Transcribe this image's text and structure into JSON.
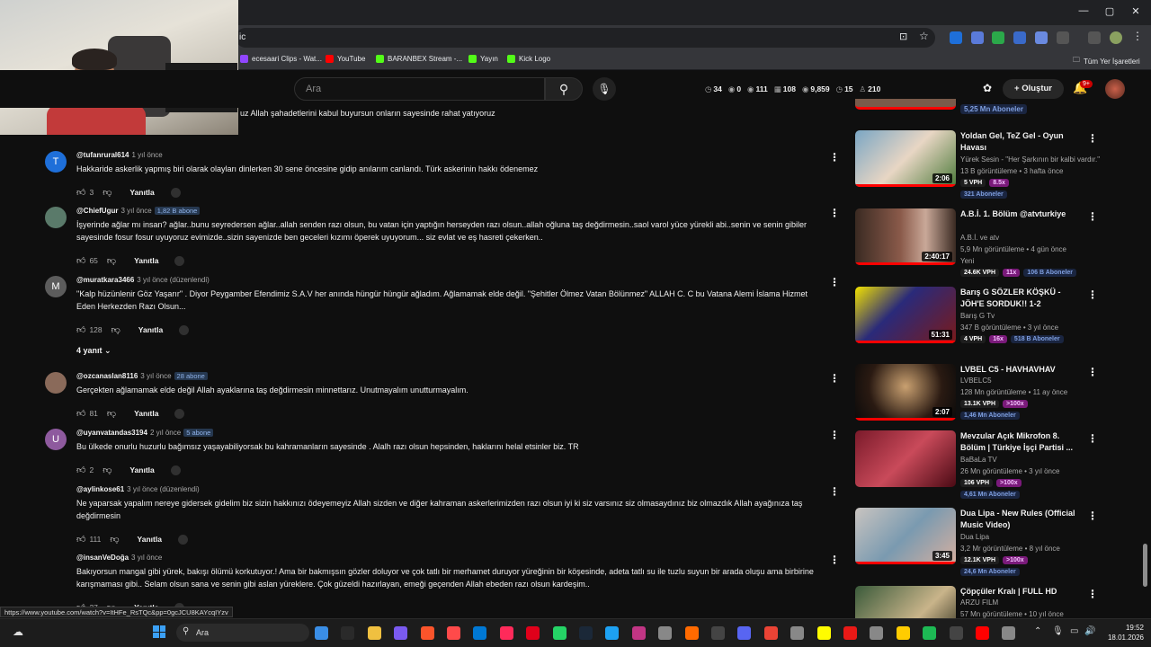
{
  "browser": {
    "address_fragment": "ic",
    "bookmarks": [
      {
        "label": "ecesaari Clips - Wat...",
        "color": "#9146ff"
      },
      {
        "label": "YouTube",
        "color": "#ff0000"
      },
      {
        "label": "BARANBEX Stream -...",
        "color": "#53fc18"
      },
      {
        "label": "Yayın",
        "color": "#53fc18"
      },
      {
        "label": "Kick Logo",
        "color": "#53fc18"
      }
    ],
    "bookmarks_folder": "Tüm Yer İşaretleri"
  },
  "header": {
    "search_placeholder": "Ara",
    "create_label": "Oluştur",
    "notif_count": "9+",
    "stats": [
      {
        "icon": "◷",
        "value": "34"
      },
      {
        "icon": "◉",
        "value": "0"
      },
      {
        "icon": "◉",
        "value": "111"
      },
      {
        "icon": "▦",
        "value": "108"
      },
      {
        "icon": "◉",
        "value": "9,859"
      },
      {
        "icon": "◷",
        "value": "15"
      },
      {
        "icon": "♙",
        "value": "210"
      }
    ]
  },
  "comments": {
    "partial_top": "uz Allah şahadetlerini kabul buyursun onların sayesinde rahat yatıyoruz",
    "reply_label": "Yanıtla",
    "replies_toggle": "4 yanıt",
    "items": [
      {
        "author": "@tufanrural614",
        "time": "1 yıl önce",
        "badge": "",
        "avatar_letter": "T",
        "avatar_color": "#1e6fd9",
        "text": "Hakkaride  askerlik yapmış biri olarak olayları dinlerken 30 sene öncesine gidip anılarım canlandı. Türk askerinin hakkı ödenemez",
        "likes": "3"
      },
      {
        "author": "@ChiefUgur",
        "time": "3 yıl önce",
        "badge": "1,82 B abone",
        "avatar_letter": "",
        "avatar_color": "#5a7a6a",
        "text": "İşyerinde ağlar mı insan? ağlar..bunu seyredersen ağlar..allah senden razı olsun, bu vatan için yaptığın herseyden razı olsun..allah oğluna taş değdirmesin..saol varol yüce yürekli abi..senin ve senin gibiler sayesinde fosur fosur uyuyoruz evimizde..sizin sayenizde ben geceleri kızımı öperek uyuyorum... siz evlat ve eş hasreti çekerken..",
        "likes": "65"
      },
      {
        "author": "@muratkara3466",
        "time": "3 yıl önce (düzenlendi)",
        "badge": "",
        "avatar_letter": "M",
        "avatar_color": "#5c5c5c",
        "text": "\"Kalp hüzünlenir Göz Yaşarır\" . Diyor Peygamber Efendimiz S.A.V her anında hüngür hüngür ağladım. Ağlamamak elde değil. \"Şehitler Ölmez Vatan Bölünmez\" ALLAH C. C bu  Vatana Alemi İslama Hizmet Eden Herkezden Razı Olsun...",
        "likes": "128"
      },
      {
        "author": "@ozcanaslan8116",
        "time": "3 yıl önce",
        "badge": "28 abone",
        "avatar_letter": "",
        "avatar_color": "#8a6a5a",
        "text": "Gerçekten ağlamamak elde değil Allah ayaklarına taş değdirmesin minnettarız. Unutmayalım unutturmayalım.",
        "likes": "81"
      },
      {
        "author": "@uyanvatandas3194",
        "time": "2 yıl önce",
        "badge": "5 abone",
        "avatar_letter": "U",
        "avatar_color": "#8e5a9e",
        "text": "Bu ülkede onurlu huzurlu bağımsız yaşayabiliyorsak bu kahramanların sayesinde . Alalh razı olsun hepsinden, haklarını helal etsinler biz. TR",
        "likes": "2"
      },
      {
        "author": "@aylinkose61",
        "time": "3 yıl önce (düzenlendi)",
        "badge": "",
        "avatar_letter": "",
        "avatar_color": "",
        "text": "Ne yaparsak yapalım nereye gidersek gidelim biz sizin hakkınızı ödeyemeyiz Allah sizden ve diğer kahraman askerlerimizden razı olsun iyi ki siz varsınız siz olmasaydınız biz olmazdık Allah ayağınıza taş değdirmesin",
        "likes": "111"
      },
      {
        "author": "@insanVeDoğa",
        "time": "3 yıl önce",
        "badge": "",
        "avatar_letter": "",
        "avatar_color": "",
        "text": "Bakıyorsun mangal gibi yürek, bakışı ölümü korkutuyor.! Ama bir bakmışsın gözler doluyor ve çok tatlı bir merhamet duruyor yüreğinin bir köşesinde, adeta tatlı su ile tuzlu suyun bir arada oluşu ama birbirine karışmaması gibi.. Selam olsun sana ve senin gibi aslan yüreklere. Çok güzeldi hazırlayan, emeği geçenden Allah ebeden razı olsun kardeşim..",
        "likes": "37"
      }
    ]
  },
  "sidebar": {
    "partial_top_sub": "5,25 Mn Aboneler",
    "items": [
      {
        "title": "Yoldan Gel, TeZ Gel - Oyun Havası",
        "channel": "Yürek Sesin - \"Her Şarkının bir kalbi vardır.\"",
        "meta": "13 B görüntüleme • 3 hafta önce",
        "vph": "5 VPH",
        "mult": "8.5x",
        "subs": "321 Aboneler",
        "duration": "2:06",
        "thumb": "linear-gradient(135deg,#7aa6c4,#e8d6c4 50%,#4c7a3a)"
      },
      {
        "title": "A.B.İ. 1. Bölüm @atvturkiye",
        "channel": "A.B.İ. ve atv",
        "meta": "5,9 Mn görüntüleme • 4 gün önce",
        "extra": "Yeni",
        "vph": "24.6K VPH",
        "mult": "11x",
        "subs": "106 B Aboneler",
        "duration": "2:40:17",
        "thumb": "linear-gradient(90deg,#3a2a22,#8a5a4a 45%,#c9a898 70%,#3a2a22)"
      },
      {
        "title": "Barış G SÖZLER KÖŞKÜ - JÖH'E SORDUK!! 1-2 BÖLÜMLERİNİ ...",
        "channel": "Barış G Tv",
        "meta": "347 B görüntüleme • 3 yıl önce",
        "vph": "4 VPH",
        "mult": "16x",
        "subs": "518 B Aboneler",
        "duration": "51:31",
        "thumb": "linear-gradient(135deg,#f2e200,#2a2a7a 40%,#7a1a1a)"
      },
      {
        "title": "LVBEL C5 - HAVHAVHAV",
        "channel": "LVBELC5",
        "meta": "128 Mn görüntüleme • 11 ay önce",
        "vph": "13.1K VPH",
        "mult": ">100x",
        "subs": "1,46 Mn Aboneler",
        "duration": "2:07",
        "thumb": "radial-gradient(circle at 50% 40%,#c9a070,#2a1a12 60%,#0a0a0a)"
      },
      {
        "title": "Mevzular Açık Mikrofon 8. Bölüm | Türkiye İşçi Partisi ...",
        "channel": "BaBaLa TV",
        "meta": "26 Mn görüntüleme • 3 yıl önce",
        "vph": "106 VPH",
        "mult": ">100x",
        "subs": "4,61 Mn Aboneler",
        "duration": "",
        "thumb": "linear-gradient(135deg,#7a1a2a,#c94a5a 50%,#4a0a14)"
      },
      {
        "title": "Dua Lipa - New Rules (Official Music Video)",
        "channel": "Dua Lipa",
        "meta": "3,2 Mr görüntüleme • 8 yıl önce",
        "vph": "12.1K VPH",
        "mult": ">100x",
        "subs": "24,6 Mn Aboneler",
        "duration": "3:45",
        "thumb": "linear-gradient(135deg,#c9c4c0,#7a9ab0 50%,#d6b0a0)"
      },
      {
        "title": "Çöpçüler Kralı | FULL HD",
        "channel": "ARZU FILM",
        "meta": "57 Mn görüntüleme • 10 yıl önce",
        "vph": "",
        "mult": "",
        "subs": "",
        "duration": "",
        "thumb": "linear-gradient(135deg,#3a5a3a,#c9b48a 60%,#2a2a1a)"
      }
    ]
  },
  "status_url": "https://www.youtube.com/watch?v=ItHFe_RsTQc&pp=0gcJCU8KAYcqIYzv",
  "taskbar": {
    "search_label": "Ara",
    "time": "19:52",
    "date": "18.01.2026",
    "icons": [
      "#3a8ee6",
      "#2a2a2a",
      "#f0c040",
      "#7a5af0",
      "#fb542b",
      "#ff4a4a",
      "#0078d4",
      "#ff2a5a",
      "#e0001a",
      "#25d366",
      "#1b2838",
      "#1da1f2",
      "#c13584",
      "#888",
      "#ff6a00",
      "#444",
      "#5865f2",
      "#ea4335",
      "#888",
      "#fffc00",
      "#e91916",
      "#888",
      "#ffcc00",
      "#1db954",
      "#444",
      "#ff0000",
      "#888"
    ]
  }
}
